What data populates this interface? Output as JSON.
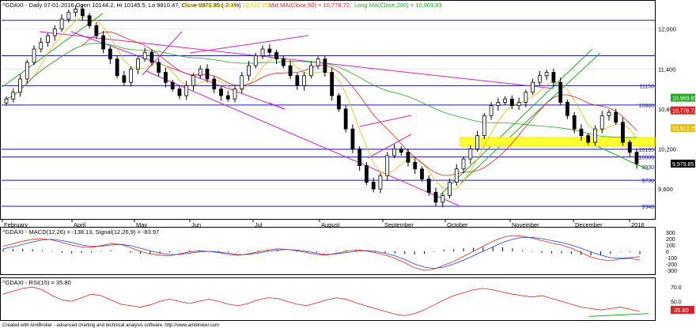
{
  "header": {
    "symbol": "^GDAXI - Daily 07-01-2016 Open 10144.2, Hi 10145.5, Lo 9810.47, Close 9979.85 (-2.3%)",
    "short_ma": "Short MA(Close,20) = 10,512.75,",
    "mid_ma": "Mid MA(Close,50) = 10,778.72,",
    "long_ma": "Long MA(Close,200) = 10,969.83"
  },
  "price_axis": {
    "ticks": [
      {
        "label": "12,000",
        "value": 12000
      },
      {
        "label": "11,400",
        "value": 11400
      },
      {
        "label": "10,800",
        "value": 10800
      },
      {
        "label": "10,200",
        "value": 10200
      },
      {
        "label": "9,600",
        "value": 9600
      }
    ],
    "ylim": [
      9150,
      12400
    ]
  },
  "levels": [
    {
      "label": "11150",
      "value": 11150
    },
    {
      "label": "10860",
      "value": 10860
    },
    {
      "label": "10195",
      "value": 10195
    },
    {
      "label": "10080",
      "value": 10080
    },
    {
      "label": "9930",
      "value": 9930
    },
    {
      "label": "9730",
      "value": 9730
    },
    {
      "label": "9340",
      "value": 9340
    }
  ],
  "horizontal_lines": [
    12130,
    11600,
    11150,
    10860,
    10195,
    10080,
    9730,
    9340
  ],
  "value_tags": [
    {
      "label": "10,969.83",
      "value": 10969.83,
      "color": "#22aa22"
    },
    {
      "label": "10,778.72",
      "value": 10778.72,
      "color": "#dd2222"
    },
    {
      "label": "10,512.75",
      "value": 10512.75,
      "color": "#e8c000"
    },
    {
      "label": "9,979.85",
      "value": 9979.85,
      "color": "#000000"
    }
  ],
  "months": [
    "February",
    "April",
    "May",
    "Jun",
    "Jul",
    "August",
    "September",
    "October",
    "November",
    "December",
    "2016"
  ],
  "macd": {
    "label": "^GDAXI - MACD(12,26) = -138.13, Signal(12,26,9) = -83.97",
    "ticks": [
      {
        "label": "300",
        "value": 300
      },
      {
        "label": "200",
        "value": 200
      },
      {
        "label": "100",
        "value": 100
      },
      {
        "label": "0",
        "value": 0
      },
      {
        "label": "-100",
        "value": -100
      },
      {
        "label": "-200",
        "value": -200
      },
      {
        "label": "-300",
        "value": -300
      }
    ],
    "ylim": [
      -350,
      350
    ],
    "macd_values": [
      80,
      120,
      160,
      190,
      200,
      180,
      140,
      100,
      70,
      60,
      90,
      120,
      110,
      60,
      0,
      -40,
      -60,
      -70,
      -40,
      -10,
      10,
      0,
      -20,
      -50,
      -60,
      -40,
      -10,
      20,
      40,
      30,
      10,
      -20,
      -50,
      -60,
      -30,
      0,
      20,
      10,
      -20,
      -60,
      -110,
      -180,
      -260,
      -300,
      -280,
      -220,
      -160,
      -80,
      0,
      80,
      160,
      220,
      250,
      240,
      210,
      170,
      130,
      100,
      50,
      -20,
      -90,
      -130,
      -150,
      -120,
      -110,
      -138
    ],
    "signal_values": [
      40,
      70,
      110,
      150,
      180,
      190,
      170,
      140,
      100,
      80,
      80,
      100,
      110,
      90,
      50,
      10,
      -30,
      -50,
      -50,
      -30,
      -10,
      0,
      -10,
      -30,
      -50,
      -50,
      -30,
      0,
      20,
      30,
      20,
      0,
      -30,
      -50,
      -40,
      -20,
      0,
      10,
      0,
      -30,
      -70,
      -130,
      -200,
      -250,
      -270,
      -250,
      -200,
      -140,
      -70,
      0,
      70,
      140,
      190,
      220,
      220,
      200,
      170,
      140,
      100,
      50,
      -10,
      -60,
      -100,
      -110,
      -100,
      -84
    ]
  },
  "rsi": {
    "label": "^GDAXI - RSI(15) = 35.80",
    "ticks": [
      {
        "label": "70.0",
        "value": 70
      },
      {
        "label": "50.0",
        "value": 50
      }
    ],
    "current_label": "35.80",
    "current_value": 35.8,
    "ylim": [
      25,
      80
    ],
    "values": [
      60,
      64,
      68,
      70,
      66,
      58,
      52,
      50,
      55,
      60,
      58,
      52,
      46,
      44,
      42,
      45,
      50,
      53,
      50,
      47,
      50,
      53,
      50,
      46,
      44,
      47,
      52,
      55,
      54,
      50,
      46,
      44,
      48,
      52,
      55,
      53,
      48,
      44,
      40,
      36,
      32,
      30,
      33,
      38,
      45,
      52,
      58,
      62,
      66,
      68,
      66,
      63,
      60,
      58,
      56,
      58,
      54,
      50,
      46,
      42,
      40,
      38,
      40,
      42,
      39,
      36
    ]
  },
  "footer": {
    "text": "Created with AmiBroker - advanced charting and technical analysis software. http://www.amibroker.com"
  },
  "chart_data": [
    {
      "type": "candlestick",
      "title": "^GDAXI - Daily 07-01-2016 Open 10144.2, Hi 10145.5, Lo 9810.47, Close 9979.85 (-2.3%)",
      "x_categories": [
        "February",
        "April",
        "May",
        "Jun",
        "Jul",
        "August",
        "September",
        "October",
        "November",
        "December",
        "2016"
      ],
      "ylim": [
        9150,
        12400
      ],
      "series": [
        {
          "name": "Short MA(Close,20)",
          "last": 10512.75,
          "color": "#e8c000"
        },
        {
          "name": "Mid MA(Close,50)",
          "last": 10778.72,
          "color": "#dd2222"
        },
        {
          "name": "Long MA(Close,200)",
          "last": 10969.83,
          "color": "#22aa22"
        }
      ],
      "closes": [
        10950,
        11050,
        11250,
        11500,
        11700,
        11800,
        11900,
        12000,
        12150,
        12250,
        12300,
        12200,
        12050,
        11900,
        11700,
        11550,
        11300,
        11200,
        11400,
        11550,
        11650,
        11500,
        11350,
        11200,
        11100,
        11000,
        11150,
        11300,
        11400,
        11250,
        11100,
        11000,
        10950,
        11100,
        11300,
        11450,
        11600,
        11700,
        11650,
        11550,
        11450,
        11300,
        11150,
        11300,
        11450,
        11550,
        11350,
        11000,
        10800,
        10500,
        10200,
        9950,
        9700,
        9600,
        9800,
        10100,
        10200,
        10150,
        10000,
        9900,
        9750,
        9550,
        9400,
        9500,
        9700,
        9900,
        10050,
        10200,
        10400,
        10700,
        10850,
        10900,
        10950,
        10850,
        10900,
        11050,
        11200,
        11300,
        11350,
        11200,
        10900,
        10700,
        10500,
        10400,
        10300,
        10500,
        10700,
        10750,
        10600,
        10300,
        10150,
        9980
      ],
      "annotations": [
        "11150",
        "10860",
        "10195",
        "10080",
        "9930",
        "9730",
        "9340"
      ]
    },
    {
      "type": "line",
      "title": "^GDAXI - MACD(12,26) = -138.13, Signal(12,26,9) = -83.97",
      "ylim": [
        -350,
        350
      ],
      "series": [
        {
          "name": "MACD(12,26)",
          "last": -138.13,
          "color": "#dd2222"
        },
        {
          "name": "Signal(12,26,9)",
          "last": -83.97,
          "color": "#2244dd"
        }
      ]
    },
    {
      "type": "line",
      "title": "^GDAXI - RSI(15) = 35.80",
      "ylim": [
        25,
        80
      ],
      "series": [
        {
          "name": "RSI(15)",
          "last": 35.8,
          "color": "#dd2222"
        }
      ]
    }
  ]
}
